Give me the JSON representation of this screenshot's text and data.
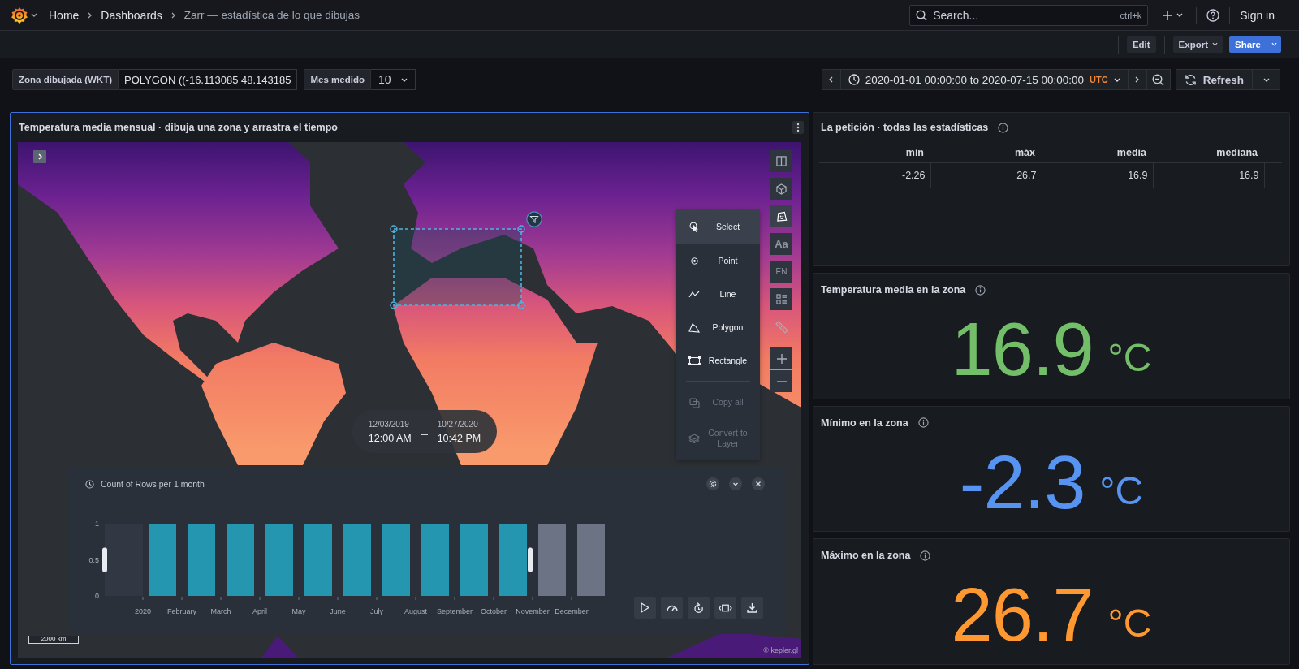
{
  "top_nav": {
    "breadcrumbs": [
      {
        "label": "Home",
        "current": false
      },
      {
        "label": "Dashboards",
        "current": false
      },
      {
        "label": "Zarr — estadística de lo que dibujas",
        "current": true
      }
    ],
    "search": {
      "placeholder": "Search...",
      "shortcut": "ctrl+k"
    },
    "sign_in": "Sign in"
  },
  "dashboard_toolbar": {
    "buttons": [
      {
        "label": "Edit",
        "kind": "edit"
      },
      {
        "label": "Export",
        "kind": "export"
      },
      {
        "label": "Share",
        "kind": "share"
      }
    ]
  },
  "variables": [
    {
      "label": "Zona dibujada (WKT)",
      "kind": "text",
      "value": "POLYGON ((-16.113085 48.143185"
    },
    {
      "label": "Mes medido",
      "kind": "select",
      "value": "10"
    }
  ],
  "time_picker": {
    "range": "2020-01-01 00:00:00 to 2020-07-15 00:00:00",
    "timezone": "UTC",
    "refresh": "Refresh"
  },
  "map_panel": {
    "title": "Temperatura media mensual · dibuja una zona y arrastra el tiempo",
    "toolbar": [
      {
        "kind": "split",
        "active": false
      },
      {
        "kind": "cube",
        "active": false
      },
      {
        "kind": "draw",
        "active": true
      },
      {
        "kind": "font",
        "label": "Aa",
        "active": false
      },
      {
        "kind": "locale",
        "label": "EN",
        "active": false
      },
      {
        "kind": "legend",
        "active": false
      },
      {
        "kind": "ruler",
        "active": false
      },
      {
        "kind": "zoom-in",
        "active": false
      },
      {
        "kind": "zoom-out",
        "active": false
      }
    ],
    "draw_menu": {
      "tools": [
        {
          "kind": "select",
          "label": "Select",
          "selected": true
        },
        {
          "kind": "point",
          "label": "Point",
          "selected": false
        },
        {
          "kind": "line",
          "label": "Line",
          "selected": false
        },
        {
          "kind": "polygon",
          "label": "Polygon",
          "selected": false
        },
        {
          "kind": "rectangle",
          "label": "Rectangle",
          "selected": false
        }
      ],
      "actions": [
        {
          "kind": "copy",
          "label": "Copy all",
          "disabled": true
        },
        {
          "kind": "convert",
          "label": "Convert to Layer",
          "disabled": true
        }
      ]
    },
    "time_window": {
      "start_date": "12/03/2019",
      "start_time": "12:00 AM",
      "end_date": "10/27/2020",
      "end_time": "10:42 PM"
    },
    "timeline": {
      "chart_data": {
        "type": "bar",
        "title": "Count of Rows per 1 month",
        "categories": [
          "2020",
          "February",
          "March",
          "April",
          "May",
          "June",
          "July",
          "August",
          "September",
          "October",
          "November",
          "December"
        ],
        "series": [
          {
            "color": "#2596b0",
            "values": [
              1,
              1,
              1,
              1,
              1,
              1,
              1,
              1,
              1,
              1,
              null,
              null
            ]
          },
          {
            "color": "#6b7385",
            "values": [
              null,
              null,
              null,
              null,
              null,
              null,
              null,
              null,
              null,
              null,
              1,
              1
            ]
          }
        ],
        "ylim": [
          0,
          1
        ],
        "yticks": [
          0,
          0.5,
          1
        ]
      }
    },
    "scale": "2000 km",
    "attribution": "© kepler.gl"
  },
  "stats_table": {
    "title": "La petición · todas las estadísticas",
    "columns": [
      "mín",
      "máx",
      "media",
      "mediana"
    ],
    "rows": [
      [
        "-2.26",
        "26.7",
        "16.9",
        "16.9"
      ]
    ]
  },
  "stat_panels": [
    {
      "title": "Temperatura media en la zona",
      "value": "16.9",
      "unit": "°C",
      "color": "#73bf69"
    },
    {
      "title": "Mínimo en la zona",
      "value": "-2.3",
      "unit": "°C",
      "color": "#5794f2"
    },
    {
      "title": "Máximo en la zona",
      "value": "26.7",
      "unit": "°C",
      "color": "#ff9830"
    }
  ]
}
